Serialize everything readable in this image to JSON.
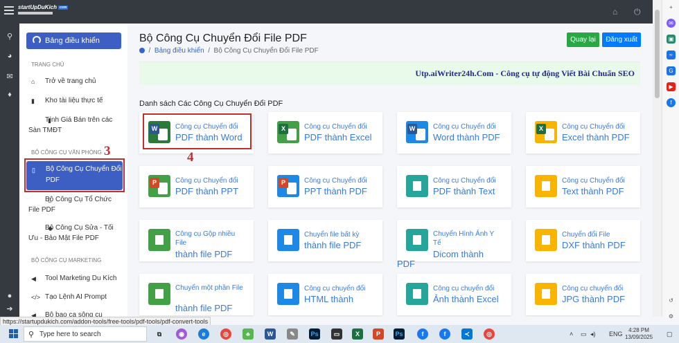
{
  "brand": {
    "name": "startUpDuKich",
    "badge": "com"
  },
  "sidebar": {
    "dashboard_label": "Bảng điều khiển",
    "section_home": "TRANG CHỦ",
    "home_items": [
      {
        "label": "Trở về trang chủ",
        "icon": "home-icon"
      },
      {
        "label": "Kho tài liệu thực tế",
        "icon": "file-icon"
      },
      {
        "label": "Tính Giá Bán trên các Sàn TMĐT",
        "icon": "file-icon"
      }
    ],
    "section_office": "BỘ CÔNG CỤ VĂN PHÒNG",
    "office_items": [
      {
        "label": "Bộ Công Cụ Chuyển Đổi PDF",
        "icon": "pdf-file-icon",
        "active": true
      },
      {
        "label": "Bộ Công Cụ Tổ Chức File PDF",
        "icon": "file-icon"
      },
      {
        "label": "Bộ Công Cụ Sửa - Tối Ưu - Bảo Mật File PDF",
        "icon": "shield-icon"
      }
    ],
    "section_marketing": "BỘ CÔNG CỤ MARKETING",
    "marketing_items": [
      {
        "label": "Tool Marketing Du Kích",
        "icon": "megaphone-icon"
      },
      {
        "label": "Tạo Lệnh AI Prompt",
        "icon": "code-icon"
      },
      {
        "label": "Bộ bạo ca sông cu",
        "icon": "megaphone-icon"
      }
    ]
  },
  "annotations": {
    "step3": "3",
    "step4": "4"
  },
  "page": {
    "title": "Bộ Công Cụ Chuyển Đổi File PDF",
    "breadcrumb": [
      "Bảng điều khiển",
      "Bộ Công Cụ Chuyển Đổi File PDF"
    ],
    "back_button": "Quay lại",
    "logout_button": "Đăng xuất",
    "banner": "Utp.aiWriter24h.Com - Công cụ tự động Viết Bài Chuẩn SEO",
    "list_title": "Danh sách Các Công Cụ Chuyển Đổi PDF"
  },
  "tools": [
    {
      "top": "Công cụ Chuyển đổi",
      "bottom": "PDF thành Word",
      "icon": "word-icon",
      "color": "#2b7a3a",
      "letter": "W",
      "tile_color": "#2b5797"
    },
    {
      "top": "Công cụ Chuyển đổi",
      "bottom": "PDF thành Excel",
      "icon": "excel-icon",
      "color": "#43a047",
      "letter": "X",
      "tile_color": "#1d6f42"
    },
    {
      "top": "Công cụ Chuyển đổi",
      "bottom": "Word thành PDF",
      "icon": "word-to-pdf-icon",
      "color": "#1e88e5",
      "letter": "W",
      "tile_color": "#2b5797"
    },
    {
      "top": "Công cụ Chuyển đổi",
      "bottom": "Excel thành PDF",
      "icon": "excel-to-pdf-icon",
      "color": "#f9b400",
      "letter": "X",
      "tile_color": "#1d6f42"
    },
    {
      "top": "Công cụ Chuyển đổi",
      "bottom": "PDF thành PPT",
      "icon": "ppt-icon",
      "color": "#43a047",
      "letter": "P",
      "tile_color": "#d24726"
    },
    {
      "top": "Công cụ Chuyển đổi",
      "bottom": "PPT thành PDF",
      "icon": "ppt-to-pdf-icon",
      "color": "#1e88e5",
      "letter": "P",
      "tile_color": "#d24726"
    },
    {
      "top": "Công cụ Chuyển đổi",
      "bottom": "PDF thành Text",
      "icon": "text-icon",
      "color": "#26a69a",
      "letter": "",
      "tile_color": ""
    },
    {
      "top": "Công cụ Chuyển đổi",
      "bottom": "Text thành PDF",
      "icon": "text-to-pdf-icon",
      "color": "#f9b400",
      "letter": "",
      "tile_color": ""
    },
    {
      "top": "Công cụ Gộp nhiều File",
      "bottom": "thành file PDF",
      "icon": "merge-icon",
      "color": "#43a047",
      "letter": "",
      "tile_color": ""
    },
    {
      "top": "Chuyển file bất kỳ",
      "bottom": "thành file PDF",
      "icon": "any-file-icon",
      "color": "#1e88e5",
      "letter": "",
      "tile_color": ""
    },
    {
      "top": "Chuyển Hình Ảnh Y Tế",
      "bottom": "Dicom thành",
      "extra": "PDF",
      "icon": "dicom-icon",
      "color": "#26a69a",
      "letter": "",
      "tile_color": ""
    },
    {
      "top": "Chuyển đổi File",
      "bottom": "DXF thành PDF",
      "icon": "dxf-icon",
      "color": "#f9b400",
      "letter": "",
      "tile_color": ""
    },
    {
      "top": "Chuyển một phần File",
      "bottom": "thành file PDF",
      "icon": "partial-file-icon",
      "color": "#43a047",
      "letter": "",
      "tile_color": ""
    },
    {
      "top": "Công cụ chuyển đổi",
      "bottom": "HTML thành",
      "icon": "html-icon",
      "color": "#1e88e5",
      "letter": "",
      "tile_color": ""
    },
    {
      "top": "Công cụ chuyển đổi",
      "bottom": "Ảnh thành Excel",
      "icon": "image-to-excel-icon",
      "color": "#26a69a",
      "letter": "",
      "tile_color": ""
    },
    {
      "top": "Công cụ chuyển đổi",
      "bottom": "JPG thành PDF",
      "icon": "jpg-icon",
      "color": "#f9b400",
      "letter": "",
      "tile_color": ""
    }
  ],
  "status_url": "https://startupdukich.com/addon-tools/free-tools/pdf-tools/pdf-convert-tools",
  "taskbar": {
    "search_placeholder": "Type here to search",
    "lang": "ENG",
    "time": "4:28 PM",
    "date": "13/09/2025"
  }
}
